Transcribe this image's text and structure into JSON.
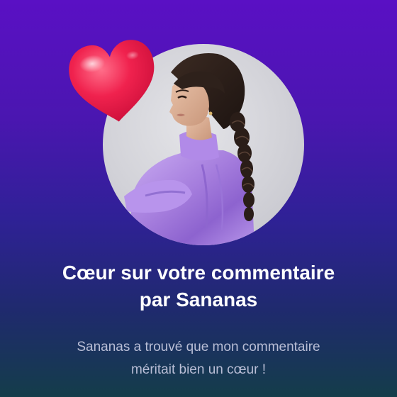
{
  "notification": {
    "title_line1": "Cœur sur votre commentaire",
    "title_line2": "par Sananas",
    "message_line1": "Sananas a trouvé que mon commentaire",
    "message_line2": "méritait bien un cœur !"
  },
  "icons": {
    "heart": "heart-icon"
  },
  "colors": {
    "background_top": "#5a10c4",
    "background_bottom": "#143d4a",
    "heart": "#f0224e",
    "title": "#ffffff",
    "message": "#b9bed6",
    "outfit": "#b48ee6"
  }
}
